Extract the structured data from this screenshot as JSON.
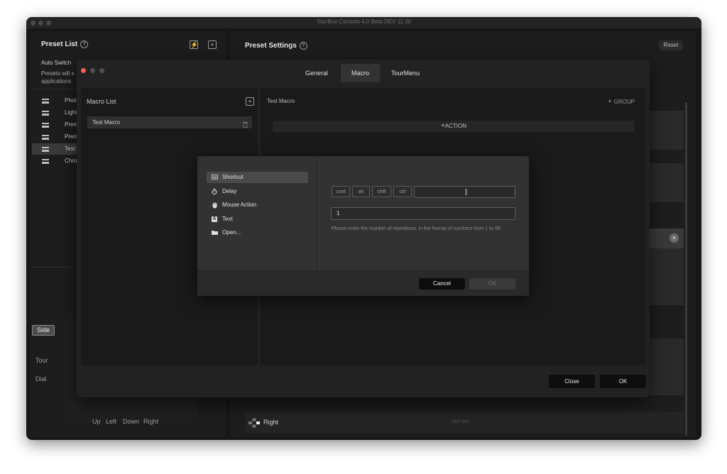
{
  "window": {
    "title": "TourBox Console 4.0 Beta DEV 11.30"
  },
  "preset_list": {
    "title": "Preset List",
    "help_icon": "question-circle-icon",
    "auto_switch_label": "Auto Switch",
    "auto_switch_desc_1": "Presets will s",
    "auto_switch_desc_2": "applications.",
    "items": [
      {
        "label": "Photo"
      },
      {
        "label": "Lightr"
      },
      {
        "label": "Premi"
      },
      {
        "label": "Premi"
      },
      {
        "label": "Test"
      },
      {
        "label": "Chron"
      }
    ],
    "selected_index": 4,
    "device_labels": {
      "side": "Side",
      "tour": "Tour",
      "dial": "Dial",
      "up": "Up",
      "left": "Left",
      "down": "Down",
      "right": "Right"
    }
  },
  "preset_settings": {
    "title": "Preset Settings",
    "reset_label": "Reset",
    "right_row_label": "Right",
    "right_row_value": "Not Set"
  },
  "macro_dialog": {
    "tabs": [
      {
        "label": "General"
      },
      {
        "label": "Macro"
      },
      {
        "label": "TourMenu"
      }
    ],
    "active_tab": 1,
    "macro_list_title": "Macro List",
    "macros": [
      {
        "label": "Test Macro"
      }
    ],
    "macro_name": "Test Macro",
    "group_label": "GROUP",
    "action_label": "ACTION",
    "close_label": "Close",
    "ok_label": "OK"
  },
  "action_dialog": {
    "items": [
      {
        "label": "Shortcut",
        "icon": "keyboard-icon"
      },
      {
        "label": "Delay",
        "icon": "timer-icon"
      },
      {
        "label": "Mouse Action",
        "icon": "mouse-icon"
      },
      {
        "label": "Text",
        "icon": "text-a-icon"
      },
      {
        "label": "Open...",
        "icon": "folder-icon"
      }
    ],
    "selected_index": 0,
    "modifiers": [
      "cmd",
      "alt",
      "shift",
      "ctrl"
    ],
    "shortcut_value": "",
    "repetitions_value": "1",
    "repetitions_hint": "Please enter the number of repetitions, in the format of numbers from 1 to 99",
    "cancel_label": "Cancel",
    "ok_label": "OK"
  },
  "colors": {
    "close_dot": "#ff5f57",
    "window_bg": "#171717",
    "dialog_bg": "#323232",
    "selected_item": "#4a4a4a"
  }
}
